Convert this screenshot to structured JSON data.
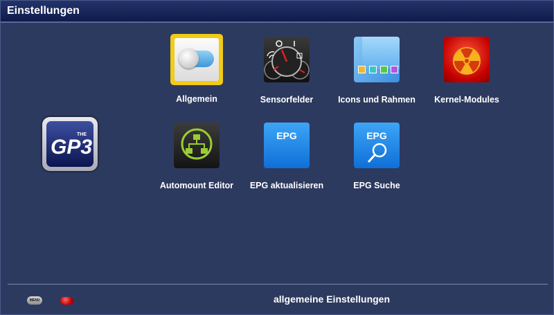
{
  "header": {
    "title": "Einstellungen"
  },
  "logo": {
    "text": "GP3",
    "small_text": "THE"
  },
  "menu": {
    "items": [
      {
        "label": "Allgemein",
        "selected": true
      },
      {
        "label": "Sensorfelder"
      },
      {
        "label": "Icons und Rahmen"
      },
      {
        "label": "Kernel-Modules"
      },
      {
        "label": "Automount Editor"
      },
      {
        "label": "EPG aktualisieren"
      },
      {
        "label": "EPG Suche"
      }
    ]
  },
  "tile_texts": {
    "epg1": "EPG",
    "epg2": "EPG"
  },
  "footer": {
    "menu_button_label": "MENU",
    "description": "allgemeine Einstellungen"
  }
}
